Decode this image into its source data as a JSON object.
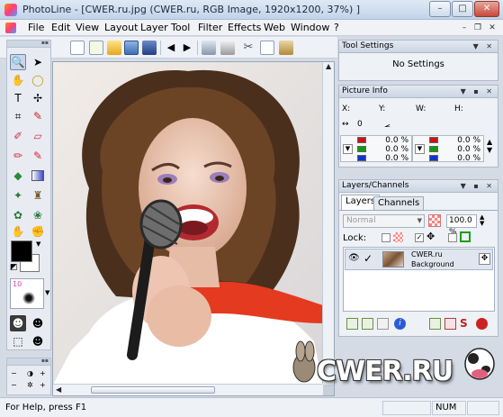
{
  "window": {
    "title": "PhotoLine - [CWER.ru.jpg  (CWER.ru, RGB Image, 1920x1200, 37%) ]",
    "minimize": "–",
    "maximize": "□",
    "close": "✕"
  },
  "menu": {
    "items": [
      "File",
      "Edit",
      "View",
      "Layout",
      "Layer",
      "Tool",
      "Filter",
      "Effects",
      "Web",
      "Window",
      "?"
    ],
    "mdi_minimize": "–",
    "mdi_restore": "❐",
    "mdi_close": "✕"
  },
  "toolbar": {
    "icons": [
      "new-document-icon",
      "new-layout-icon",
      "open-folder-icon",
      "browser-icon",
      "save-icon",
      "back-icon",
      "forward-icon",
      "scan-icon",
      "print-icon",
      "cut-icon",
      "copy-icon",
      "paste-icon"
    ]
  },
  "tool_settings": {
    "title": "Tool Settings",
    "message": "No Settings"
  },
  "picture_info": {
    "title": "Picture Info",
    "x_label": "X:",
    "y_label": "Y:",
    "w_label": "W:",
    "h_label": "H:",
    "dist_value": "0",
    "colors": [
      {
        "color": "#cc1111",
        "value": "0.0 %"
      },
      {
        "color": "#119911",
        "value": "0.0 %"
      },
      {
        "color": "#1133cc",
        "value": "0.0 %"
      }
    ]
  },
  "layers_panel": {
    "title": "Layers/Channels",
    "tabs": [
      "Layers",
      "Channels"
    ],
    "blend_mode": "Normal",
    "opacity": "100.0 %",
    "lock_label": "Lock:",
    "layer_name": "CWER.ru",
    "layer_type": "Background"
  },
  "status": {
    "help": "For Help, press F1",
    "num": "NUM"
  },
  "watermark": "CWER.RU"
}
